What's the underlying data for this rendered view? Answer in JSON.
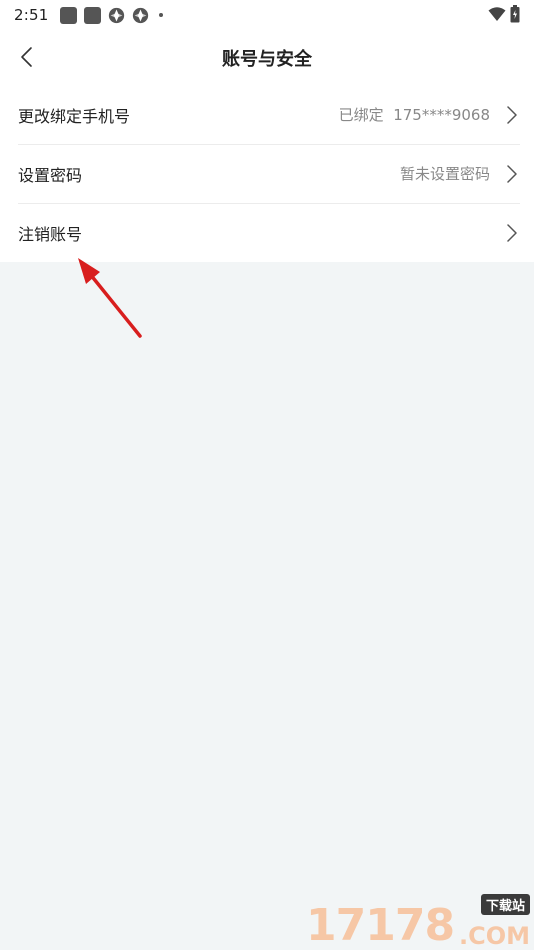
{
  "status_bar": {
    "time": "2:51"
  },
  "header": {
    "title": "账号与安全"
  },
  "list": {
    "items": [
      {
        "label": "更改绑定手机号",
        "value": "已绑定  175****9068"
      },
      {
        "label": "设置密码",
        "value": "暂未设置密码"
      },
      {
        "label": "注销账号",
        "value": ""
      }
    ]
  },
  "watermark": {
    "digits": "17178",
    "badge": "下载站",
    "domain": ".COM"
  },
  "colors": {
    "background": "#f2f5f6",
    "surface": "#ffffff",
    "secondary_text": "#888888",
    "annotation_arrow": "#d81e1e"
  },
  "icons": {
    "back": "chevron-left-icon",
    "row_chevron": "chevron-right-icon",
    "wifi": "wifi-icon",
    "battery": "battery-icon",
    "annotation": "red-arrow-icon"
  }
}
